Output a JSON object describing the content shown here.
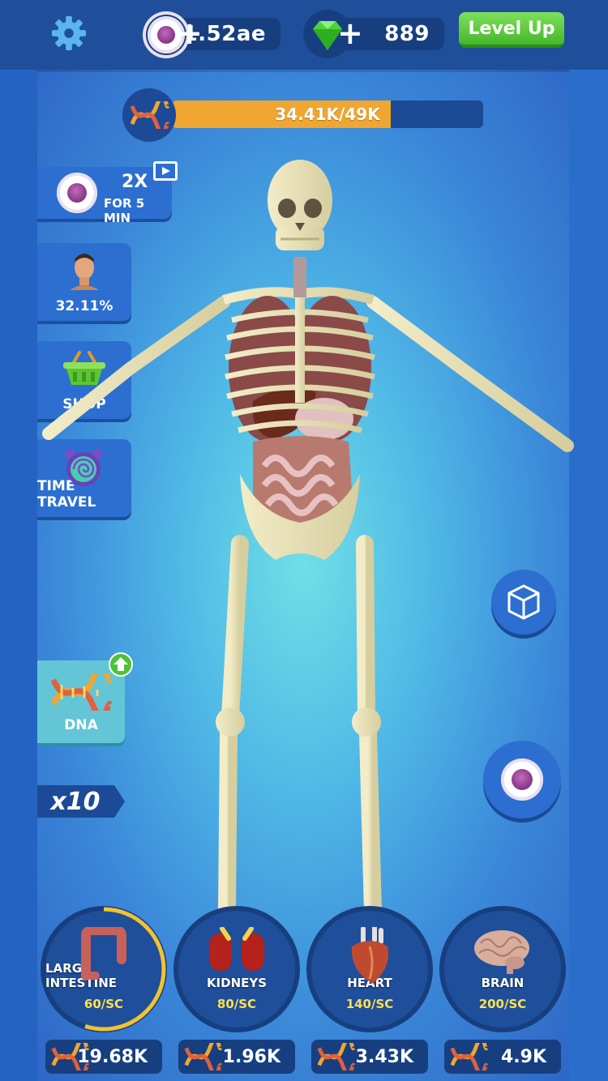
{
  "header": {
    "cells": "1.52ae",
    "gems": "889",
    "level_up_label": "Level Up"
  },
  "progress": {
    "text": "34.41K/49K",
    "current": 34.41,
    "max": 49,
    "fill_fraction": 0.7022
  },
  "boost": {
    "multiplier": "2X",
    "duration": "FOR 5 MIN"
  },
  "side_menu": {
    "evolution_percent": "32.11%",
    "shop_label": "SHOP",
    "time_travel_label": "TIME TRAVEL",
    "dna_label": "DNA",
    "multiplier_label": "x10"
  },
  "organs": [
    {
      "name": "LARGE INTESTINE",
      "rate": "60/SC",
      "price": "19.68K",
      "progress": 0.55
    },
    {
      "name": "KIDNEYS",
      "rate": "80/SC",
      "price": "1.96K",
      "progress": 0
    },
    {
      "name": "HEART",
      "rate": "140/SC",
      "price": "3.43K",
      "progress": 0
    },
    {
      "name": "BRAIN",
      "rate": "200/SC",
      "price": "4.9K",
      "progress": 0
    }
  ],
  "colors": {
    "accent_orange": "#f0a630",
    "level_up_green": "#46b82c",
    "rate_yellow": "#ffe14d",
    "panel_blue": "#1f4f9a"
  },
  "icons": [
    "gear-icon",
    "cell-icon",
    "gem-icon",
    "plus-icon",
    "dna-icon",
    "video-icon",
    "avatar-icon",
    "basket-icon",
    "clock-icon",
    "cube-icon",
    "upgrade-arrow-icon"
  ]
}
